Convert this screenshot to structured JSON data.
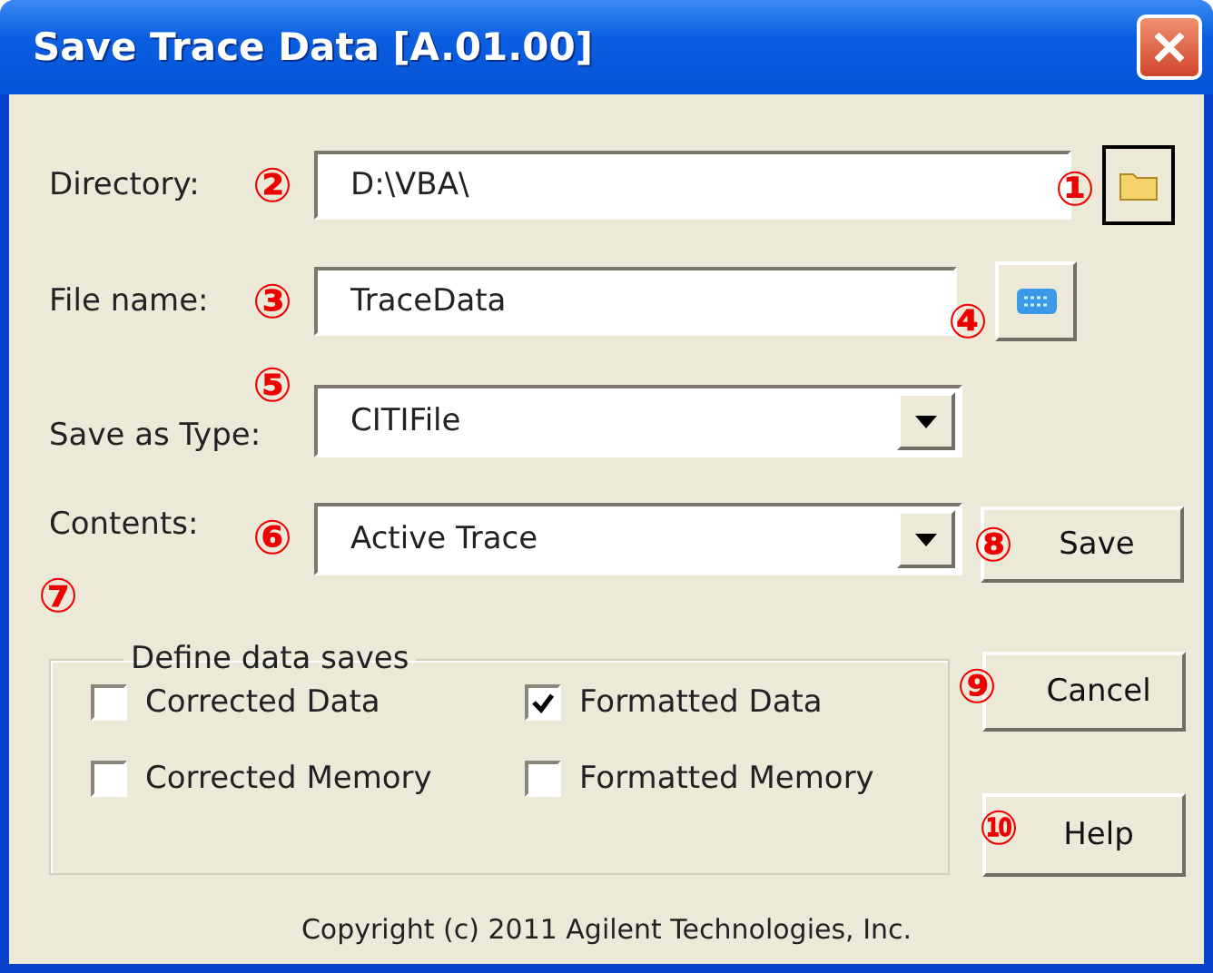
{
  "window": {
    "title": "Save Trace Data [A.01.00]"
  },
  "directory": {
    "label": "Directory:",
    "value": "D:\\VBA\\"
  },
  "file_name": {
    "label": "File name:",
    "value": "TraceData"
  },
  "save_as_type": {
    "label": "Save as Type:",
    "value": "CITIFile"
  },
  "contents": {
    "label": "Contents:",
    "value": "Active Trace"
  },
  "data_saves": {
    "title": "Define data saves",
    "options": [
      {
        "label": "Corrected Data",
        "checked": false
      },
      {
        "label": "Formatted Data",
        "checked": true
      },
      {
        "label": "Corrected Memory",
        "checked": false
      },
      {
        "label": "Formatted Memory",
        "checked": false
      }
    ]
  },
  "buttons": [
    {
      "label": "Save"
    },
    {
      "label": "Cancel"
    },
    {
      "label": "Help"
    }
  ],
  "callouts": [
    "①",
    "②",
    "③",
    "④",
    "⑤",
    "⑥",
    "⑦",
    "⑧",
    "⑨",
    "⑩"
  ],
  "copyright": "Copyright (c) 2011 Agilent Technologies, Inc."
}
